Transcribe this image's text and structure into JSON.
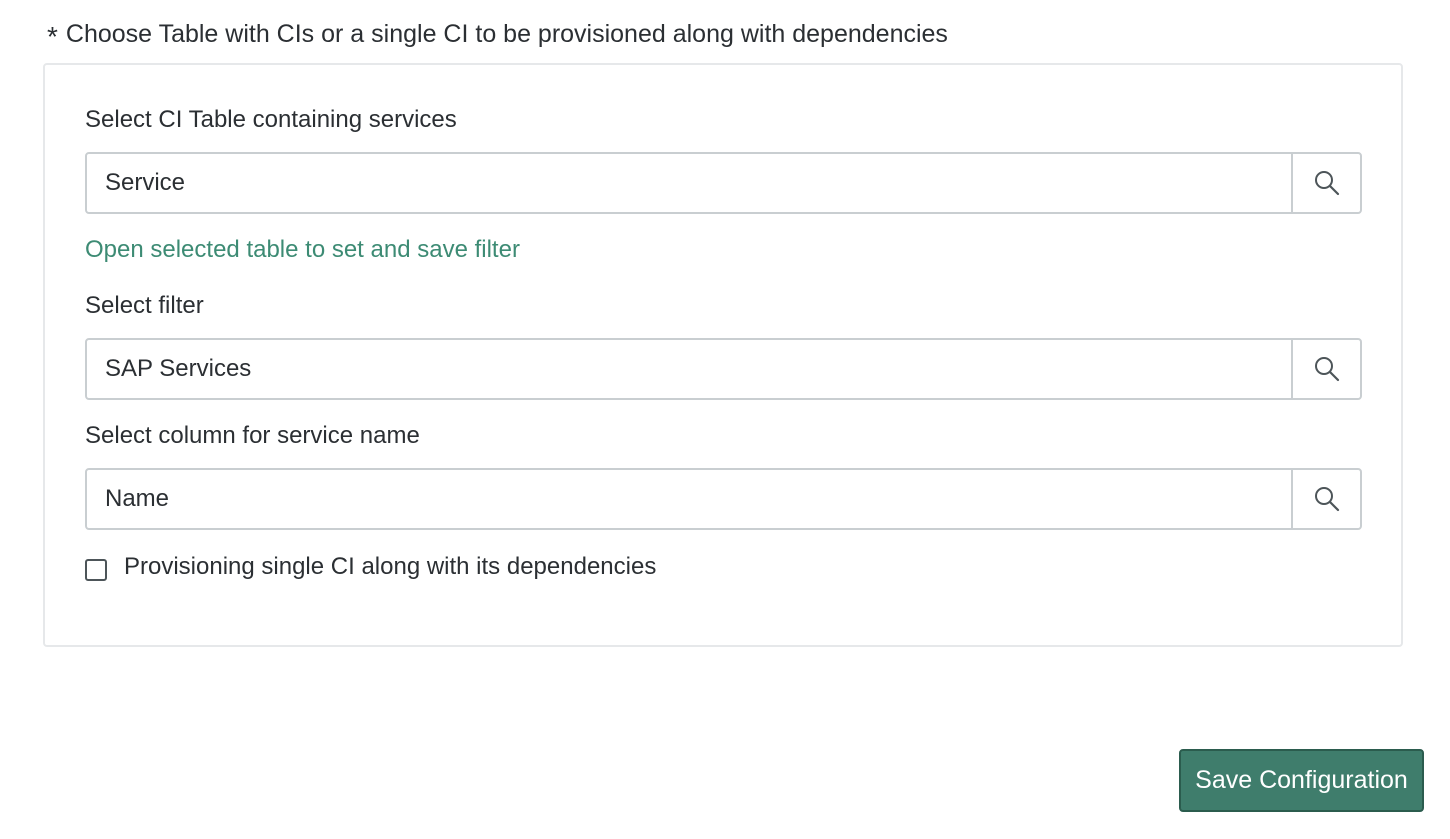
{
  "section": {
    "required_mark": "*",
    "heading": "Choose Table with CIs or a single CI to be provisioned along with dependencies"
  },
  "ci_table": {
    "label": "Select CI Table containing services",
    "value": "Service",
    "lookup_icon": "search-icon"
  },
  "open_table_link": "Open selected table to set and save filter",
  "filter": {
    "label": "Select filter",
    "value": "SAP Services",
    "lookup_icon": "search-icon"
  },
  "name_column": {
    "label": "Select column for service name",
    "value": "Name",
    "lookup_icon": "search-icon"
  },
  "single_ci": {
    "label": "Provisioning single CI along with its dependencies",
    "checked": false
  },
  "actions": {
    "save_label": "Save Configuration"
  },
  "colors": {
    "link": "#3d8b74",
    "primary_button": "#3f7d6c"
  }
}
